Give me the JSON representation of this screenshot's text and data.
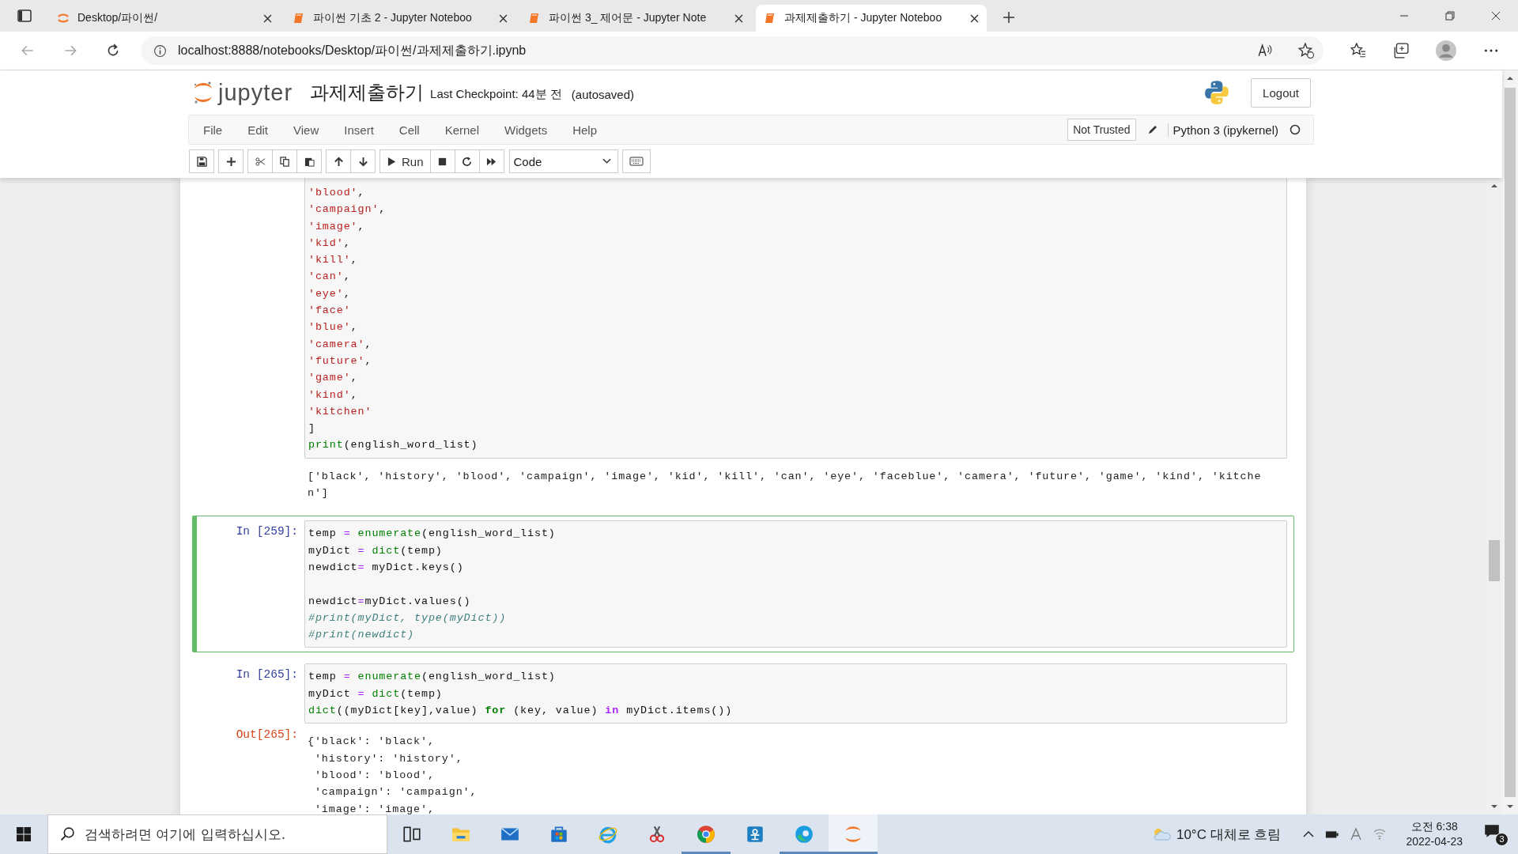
{
  "browser": {
    "tabs": [
      {
        "title": "Desktop/파이썬/",
        "kind": "folder",
        "selected": false
      },
      {
        "title": "파이썬 기초 2 - Jupyter Noteboo",
        "kind": "notebook",
        "selected": false
      },
      {
        "title": "파이썬 3_ 제어문 - Jupyter Note",
        "kind": "notebook",
        "selected": false
      },
      {
        "title": "과제제출하기 - Jupyter Noteboo",
        "kind": "notebook",
        "selected": true
      }
    ],
    "url": "localhost:8888/notebooks/Desktop/파이썬/과제제출하기.ipynb"
  },
  "header": {
    "logo_text": "jupyter",
    "notebook_title": "과제제출하기",
    "checkpoint": "Last Checkpoint: 44분 전",
    "autosave": "(autosaved)",
    "logout": "Logout"
  },
  "menu": [
    "File",
    "Edit",
    "View",
    "Insert",
    "Cell",
    "Kernel",
    "Widgets",
    "Help"
  ],
  "trust": "Not Trusted",
  "kernel": "Python 3 (ipykernel)",
  "toolbar": {
    "run": "Run",
    "cell_type": "Code"
  },
  "cells": [
    {
      "selected": false,
      "input": [
        {
          "kind": "code",
          "tokens": [
            {
              "kind": "string",
              "text": "'blood'"
            },
            {
              "kind": "plain",
              "text": ","
            }
          ]
        },
        {
          "kind": "code",
          "tokens": [
            {
              "kind": "string",
              "text": "'campaign'"
            },
            {
              "kind": "plain",
              "text": ","
            }
          ]
        },
        {
          "kind": "code",
          "tokens": [
            {
              "kind": "string",
              "text": "'image'"
            },
            {
              "kind": "plain",
              "text": ","
            }
          ]
        },
        {
          "kind": "code",
          "tokens": [
            {
              "kind": "string",
              "text": "'kid'"
            },
            {
              "kind": "plain",
              "text": ","
            }
          ]
        },
        {
          "kind": "code",
          "tokens": [
            {
              "kind": "string",
              "text": "'kill'"
            },
            {
              "kind": "plain",
              "text": ","
            }
          ]
        },
        {
          "kind": "code",
          "tokens": [
            {
              "kind": "string",
              "text": "'can'"
            },
            {
              "kind": "plain",
              "text": ","
            }
          ]
        },
        {
          "kind": "code",
          "tokens": [
            {
              "kind": "string",
              "text": "'eye'"
            },
            {
              "kind": "plain",
              "text": ","
            }
          ]
        },
        {
          "kind": "code",
          "tokens": [
            {
              "kind": "string",
              "text": "'face'"
            }
          ]
        },
        {
          "kind": "code",
          "tokens": [
            {
              "kind": "string",
              "text": "'blue'"
            },
            {
              "kind": "plain",
              "text": ","
            }
          ]
        },
        {
          "kind": "code",
          "tokens": [
            {
              "kind": "string",
              "text": "'camera'"
            },
            {
              "kind": "plain",
              "text": ","
            }
          ]
        },
        {
          "kind": "code",
          "tokens": [
            {
              "kind": "string",
              "text": "'future'"
            },
            {
              "kind": "plain",
              "text": ","
            }
          ]
        },
        {
          "kind": "code",
          "tokens": [
            {
              "kind": "string",
              "text": "'game'"
            },
            {
              "kind": "plain",
              "text": ","
            }
          ]
        },
        {
          "kind": "code",
          "tokens": [
            {
              "kind": "string",
              "text": "'kind'"
            },
            {
              "kind": "plain",
              "text": ","
            }
          ]
        },
        {
          "kind": "code",
          "tokens": [
            {
              "kind": "string",
              "text": "'kitchen'"
            }
          ]
        },
        {
          "kind": "code",
          "tokens": [
            {
              "kind": "plain",
              "text": "]"
            }
          ]
        },
        {
          "kind": "code",
          "tokens": [
            {
              "kind": "builtin",
              "text": "print"
            },
            {
              "kind": "plain",
              "text": "(english_word_list)"
            }
          ]
        }
      ],
      "output": {
        "lines": [
          "['black', 'history', 'blood', 'campaign', 'image', 'kid', 'kill', 'can', 'eye', 'faceblue', 'camera', 'future', 'game', 'kind', 'kitche",
          "n']"
        ]
      }
    },
    {
      "prompt_in": "In [259]:",
      "selected": true,
      "input": [
        {
          "kind": "code",
          "tokens": [
            {
              "kind": "plain",
              "text": "temp "
            },
            {
              "kind": "operator",
              "text": "= "
            },
            {
              "kind": "builtin",
              "text": "enumerate"
            },
            {
              "kind": "plain",
              "text": "(english_word_list)"
            }
          ]
        },
        {
          "kind": "code",
          "tokens": [
            {
              "kind": "plain",
              "text": "myDict "
            },
            {
              "kind": "operator",
              "text": "= "
            },
            {
              "kind": "builtin",
              "text": "dict"
            },
            {
              "kind": "plain",
              "text": "(temp)"
            }
          ]
        },
        {
          "kind": "code",
          "tokens": [
            {
              "kind": "plain",
              "text": "newdict"
            },
            {
              "kind": "operator",
              "text": "="
            },
            {
              "kind": "plain",
              "text": " myDict.keys()"
            }
          ]
        },
        {
          "kind": "blank"
        },
        {
          "kind": "code",
          "tokens": [
            {
              "kind": "plain",
              "text": "newdict"
            },
            {
              "kind": "operator",
              "text": "="
            },
            {
              "kind": "plain",
              "text": "myDict.values()"
            }
          ]
        },
        {
          "kind": "code",
          "tokens": [
            {
              "kind": "comment",
              "text": "#print(myDict, type(myDict))"
            }
          ]
        },
        {
          "kind": "code",
          "tokens": [
            {
              "kind": "comment",
              "text": "#print(newdict)"
            }
          ]
        }
      ]
    },
    {
      "prompt_in": "In [265]:",
      "selected": false,
      "input": [
        {
          "kind": "code",
          "tokens": [
            {
              "kind": "plain",
              "text": "temp "
            },
            {
              "kind": "operator",
              "text": "= "
            },
            {
              "kind": "builtin",
              "text": "enumerate"
            },
            {
              "kind": "plain",
              "text": "(english_word_list)"
            }
          ]
        },
        {
          "kind": "code",
          "tokens": [
            {
              "kind": "plain",
              "text": "myDict "
            },
            {
              "kind": "operator",
              "text": "= "
            },
            {
              "kind": "builtin",
              "text": "dict"
            },
            {
              "kind": "plain",
              "text": "(temp)"
            }
          ]
        },
        {
          "kind": "code",
          "tokens": [
            {
              "kind": "builtin",
              "text": "dict"
            },
            {
              "kind": "plain",
              "text": "((myDict[key],value) "
            },
            {
              "kind": "keyword",
              "text": "for"
            },
            {
              "kind": "plain",
              "text": " (key, value) "
            },
            {
              "kind": "opword",
              "text": "in"
            },
            {
              "kind": "plain",
              "text": " myDict.items())"
            }
          ]
        }
      ],
      "output": {
        "prompt": "Out[265]:",
        "lines": [
          "{'black': 'black',",
          " 'history': 'history',",
          " 'blood': 'blood',",
          " 'campaign': 'campaign',",
          " 'image': 'image',"
        ]
      }
    }
  ],
  "taskbar": {
    "search_placeholder": "검색하려면 여기에 입력하십시오.",
    "apps": [
      {
        "kind": "taskview",
        "running": false,
        "selected": false
      },
      {
        "kind": "folder",
        "running": false,
        "selected": false
      },
      {
        "kind": "mail",
        "running": false,
        "selected": false
      },
      {
        "kind": "store",
        "running": false,
        "selected": false
      },
      {
        "kind": "ie",
        "running": false,
        "selected": false
      },
      {
        "kind": "snip",
        "running": false,
        "selected": false
      },
      {
        "kind": "chrome",
        "running": true,
        "selected": false
      },
      {
        "kind": "hangul",
        "running": false,
        "selected": false
      },
      {
        "kind": "edge",
        "running": true,
        "selected": false
      },
      {
        "kind": "jupyter",
        "running": true,
        "selected": true
      }
    ],
    "weather": "10°C 대체로 흐림",
    "time": "오전 6:38",
    "date": "2022-04-23",
    "notifications": "3"
  }
}
